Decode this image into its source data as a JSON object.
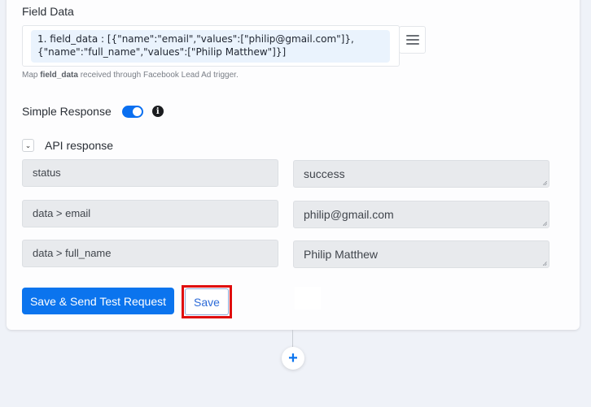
{
  "field_data": {
    "title": "Field Data",
    "chip_line1": "1. field_data : [{\"name\":\"email\",\"values\":[\"philip@gmail.com\"]},",
    "chip_line2": "{\"name\":\"full_name\",\"values\":[\"Philip Matthew\"]}]",
    "menu_icon": "hamburger-menu-icon",
    "helper_prefix": "Map ",
    "helper_bold": "field_data",
    "helper_suffix": " received through Facebook Lead Ad trigger."
  },
  "simple_response": {
    "label": "Simple Response",
    "enabled": true,
    "info_icon": "i"
  },
  "api_response": {
    "label": "API response",
    "expanded": true,
    "toggle_glyph": "⌄",
    "rows": [
      {
        "key": "status",
        "value": "success"
      },
      {
        "key": "data > email",
        "value": "philip@gmail.com"
      },
      {
        "key": "data > full_name",
        "value": "Philip Matthew"
      }
    ]
  },
  "actions": {
    "save_and_send_label": "Save & Send Test Request",
    "save_label": "Save",
    "highlight_color": "#e00d0d"
  },
  "flow": {
    "add_step_glyph": "+"
  },
  "colors": {
    "accent": "#0b74ee",
    "background": "#eff2f8"
  }
}
